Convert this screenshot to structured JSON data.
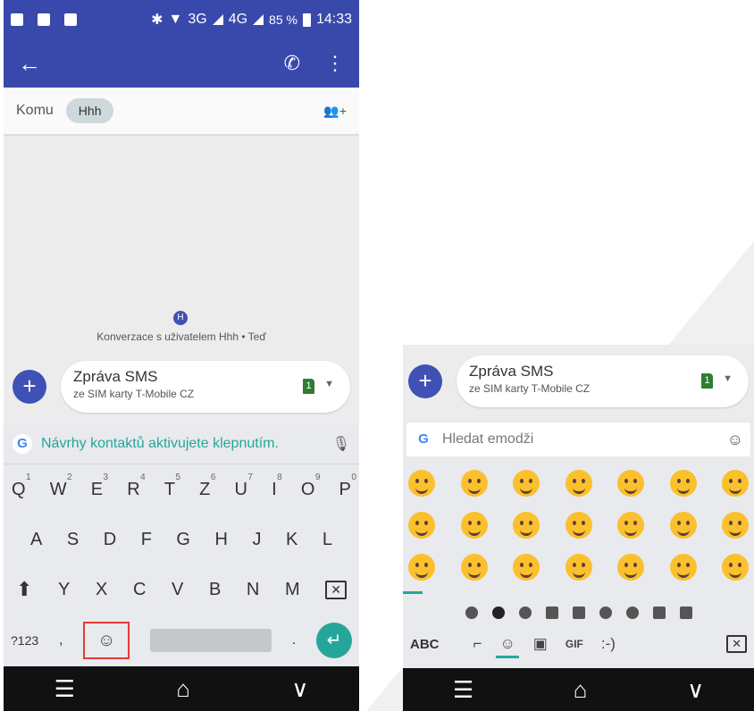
{
  "status_bar": {
    "network": "3G",
    "network2": "4G",
    "battery": "85 %",
    "time": "14:33"
  },
  "app_bar": {
    "back_icon": "arrow-back-icon",
    "call_icon": "phone-icon",
    "menu_icon": "more-vert-icon"
  },
  "recipient": {
    "label": "Komu",
    "chip": "Hhh",
    "add_icon": "add-person-icon"
  },
  "conversation": {
    "avatar_initial": "H",
    "note": "Konverzace s uživatelem Hhh • Teď"
  },
  "compose": {
    "title": "Zpráva SMS",
    "subtitle": "ze SIM karty T-Mobile CZ",
    "sim_number": "1",
    "add_label": "+"
  },
  "keyboard": {
    "suggestion": "Návrhy kontaktů aktivujete klepnutím.",
    "row1": [
      {
        "key": "Q",
        "hint": "1"
      },
      {
        "key": "W",
        "hint": "2"
      },
      {
        "key": "E",
        "hint": "3"
      },
      {
        "key": "R",
        "hint": "4"
      },
      {
        "key": "T",
        "hint": "5"
      },
      {
        "key": "Z",
        "hint": "6"
      },
      {
        "key": "U",
        "hint": "7"
      },
      {
        "key": "I",
        "hint": "8"
      },
      {
        "key": "O",
        "hint": "9"
      },
      {
        "key": "P",
        "hint": "0"
      }
    ],
    "row2": [
      "A",
      "S",
      "D",
      "F",
      "G",
      "H",
      "J",
      "K",
      "L"
    ],
    "row3": [
      "Y",
      "X",
      "C",
      "V",
      "B",
      "N",
      "M"
    ],
    "symbols_label": "?123",
    "comma": ",",
    "period": "."
  },
  "emoji_keyboard": {
    "search_placeholder": "Hledat emodži",
    "abc_label": "ABC",
    "gif_label": "GIF",
    "emoticon_label": ":-)"
  },
  "colors": {
    "primary": "#3949ab",
    "accent": "#26a69a",
    "highlight_box": "#e53935",
    "sim": "#2e7d32"
  }
}
